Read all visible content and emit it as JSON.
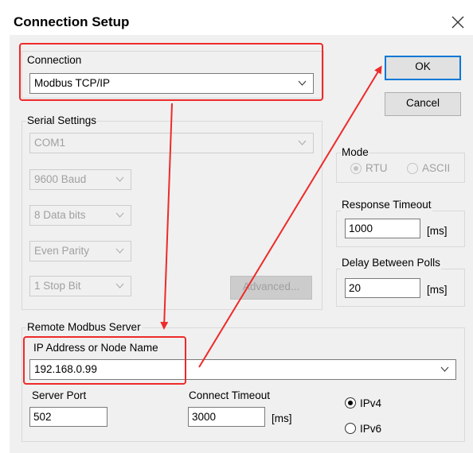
{
  "window": {
    "title": "Connection Setup"
  },
  "connection": {
    "group_label": "Connection",
    "selected": "Modbus TCP/IP"
  },
  "buttons": {
    "ok": "OK",
    "cancel": "Cancel",
    "advanced": "Advanced..."
  },
  "serial": {
    "group_label": "Serial Settings",
    "port": "COM1",
    "baud": "9600 Baud",
    "data_bits": "8 Data bits",
    "parity": "Even Parity",
    "stop_bits": "1 Stop Bit"
  },
  "mode": {
    "label": "Mode",
    "rtu": "RTU",
    "ascii": "ASCII",
    "selected": "RTU"
  },
  "response_timeout": {
    "label": "Response Timeout",
    "value": "1000",
    "unit": "[ms]"
  },
  "delay_between_polls": {
    "label": "Delay Between Polls",
    "value": "20",
    "unit": "[ms]"
  },
  "remote_server": {
    "group_label": "Remote Modbus Server",
    "ip_label": "IP Address or Node Name",
    "ip_value": "192.168.0.99",
    "port_label": "Server Port",
    "port_value": "502",
    "connect_timeout_label": "Connect Timeout",
    "connect_timeout_value": "3000",
    "connect_timeout_unit": "[ms]",
    "ipv4": "IPv4",
    "ipv6": "IPv6",
    "ip_version_selected": "IPv4"
  },
  "colors": {
    "annotation": "#ee2a2a",
    "focus": "#0078d7",
    "dialog_bg": "#f0f0f0"
  }
}
